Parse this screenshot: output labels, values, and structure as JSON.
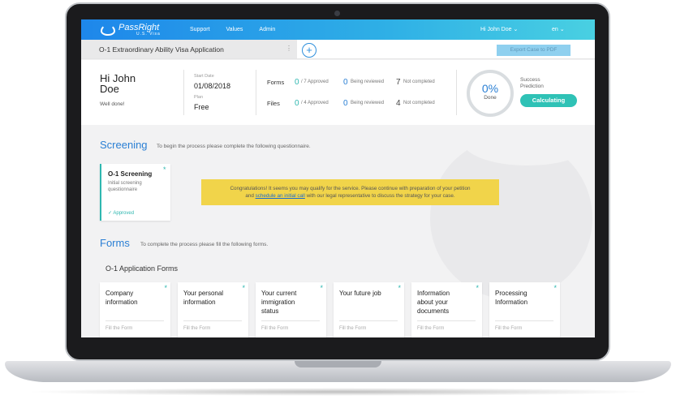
{
  "nav": {
    "logo_name": "PassRight",
    "logo_sub": "U.S. Visa",
    "links": [
      "Support",
      "Values",
      "Admin"
    ],
    "user": "Hi John Doe ⌄",
    "lang": "en ⌄"
  },
  "tabbar": {
    "active_tab": "O-1 Extraordinary Ability Visa Application",
    "more": "⋮",
    "add": "+",
    "export": "Export Case to PDF"
  },
  "summary": {
    "greeting": "Hi John Doe",
    "sub": "Well done!",
    "start_date_label": "Start Date",
    "start_date": "01/08/2018",
    "plan_label": "Plan",
    "plan": "Free",
    "forms": {
      "label": "Forms",
      "approved": "0",
      "approved_total": "/ 7 Approved",
      "reviewed": "0",
      "reviewed_lbl": "Being reviewed",
      "not_completed": "7",
      "not_completed_lbl": "Not completed"
    },
    "files": {
      "label": "Files",
      "approved": "0",
      "approved_total": "/ 4 Approved",
      "reviewed": "0",
      "reviewed_lbl": "Being reviewed",
      "not_completed": "4",
      "not_completed_lbl": "Not completed"
    },
    "done_pct": "0%",
    "done_lbl": "Done",
    "success_lbl_1": "Success",
    "success_lbl_2": "Prediction",
    "calc_btn": "Calculating"
  },
  "screening": {
    "title": "Screening",
    "desc": "To begin the process please complete the following questionnaire.",
    "card_title": "O-1 Screening",
    "card_sub_1": "Initial screening",
    "card_sub_2": "questionnaire",
    "card_status": "✓ Approved",
    "congrats_1": "Congratulations! It seems you may qualify for the service. Please continue with preparation of your petition",
    "congrats_2a": "and ",
    "congrats_link": "schedule an initial call",
    "congrats_2b": " with our legal representative to discuss the strategy for your case."
  },
  "forms": {
    "title": "Forms",
    "desc": "To complete the process please fill the following forms.",
    "group_title": "O-1 Application Forms",
    "fill_label": "Fill the Form",
    "cards": [
      {
        "l1": "Company",
        "l2": "information",
        "l3": ""
      },
      {
        "l1": "Your personal",
        "l2": "information",
        "l3": ""
      },
      {
        "l1": "Your current",
        "l2": "immigration",
        "l3": "status"
      },
      {
        "l1": "Your future job",
        "l2": "",
        "l3": ""
      },
      {
        "l1": "Information",
        "l2": "about your",
        "l3": "documents"
      },
      {
        "l1": "Processing",
        "l2": "Information",
        "l3": ""
      }
    ]
  },
  "colors": {
    "accent_blue": "#2a7fd4",
    "accent_teal": "#2fb7b0",
    "banner_yellow": "#f1d44a"
  }
}
